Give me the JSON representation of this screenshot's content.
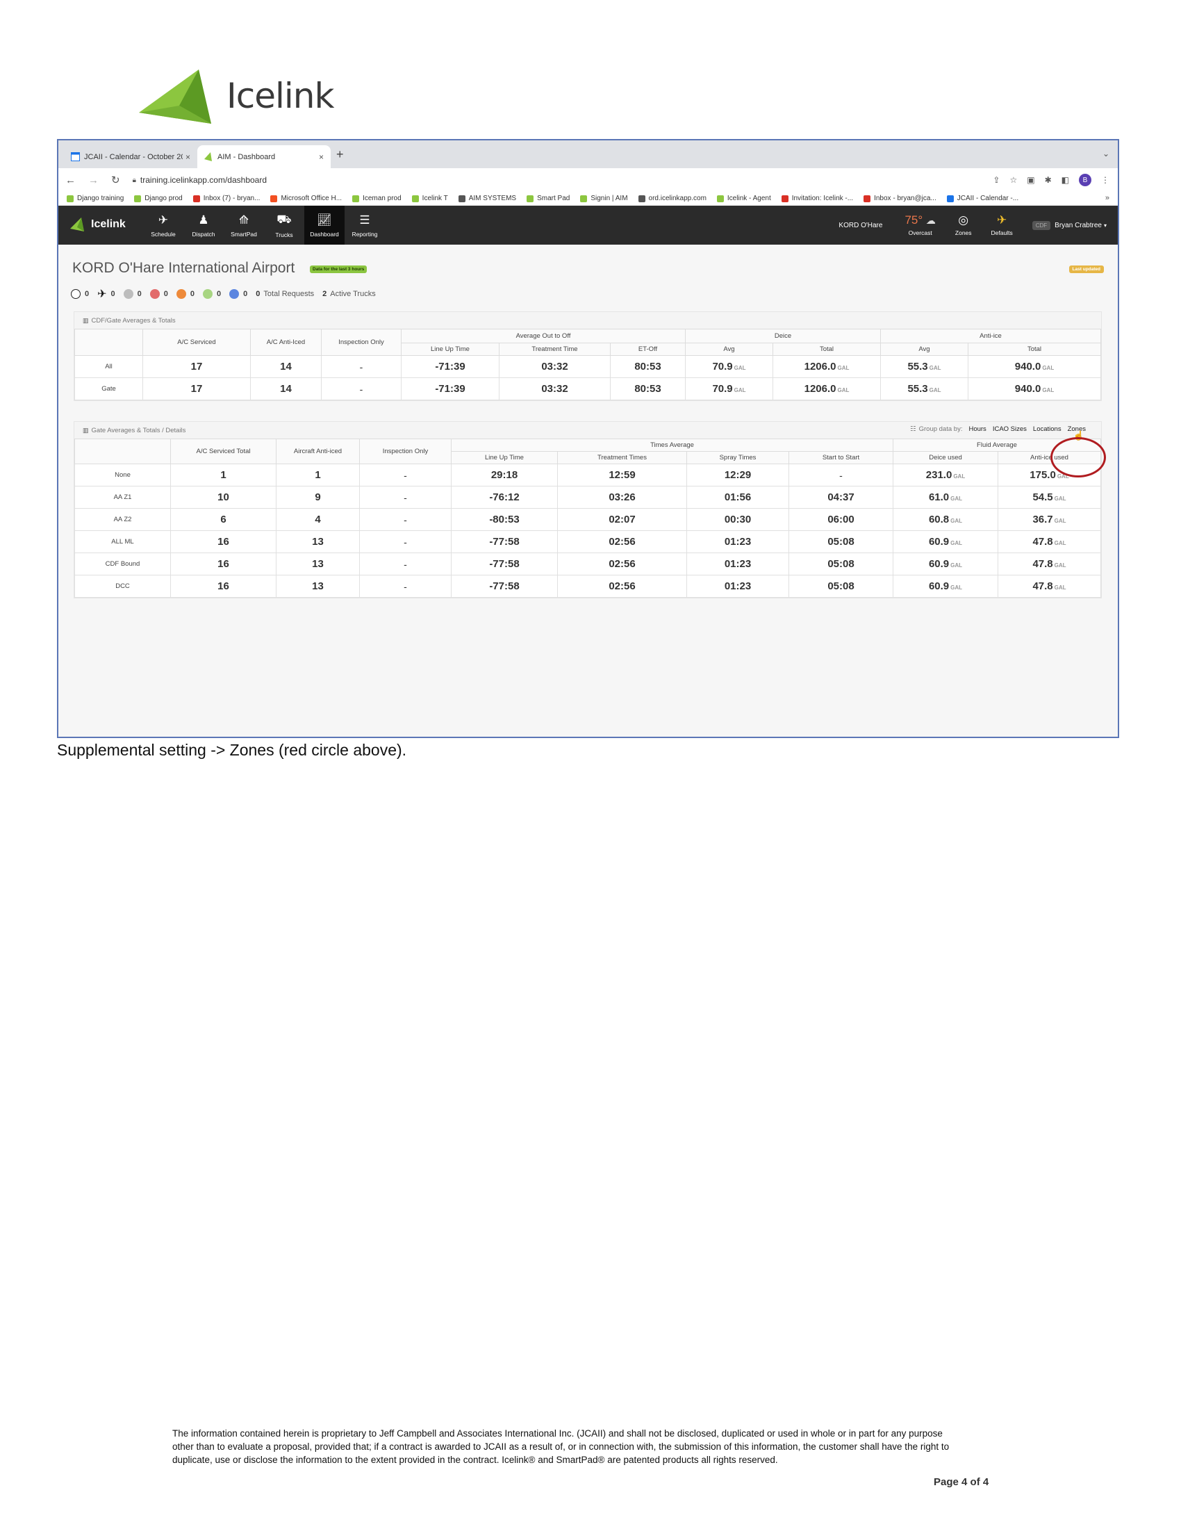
{
  "logo": {
    "text": "Icelink"
  },
  "browser": {
    "tabs": [
      {
        "title": "JCAII - Calendar - October 20..."
      },
      {
        "title": "AIM - Dashboard"
      }
    ],
    "url": "training.icelinkapp.com/dashboard",
    "profile_initial": "B",
    "bookmarks": [
      "Django training",
      "Django prod",
      "Inbox (7) - bryan...",
      "Microsoft Office H...",
      "Iceman prod",
      "Icelink T",
      "AIM SYSTEMS",
      "Smart Pad",
      "Signin | AIM",
      "ord.icelinkapp.com",
      "Icelink - Agent",
      "Invitation: Icelink -...",
      "Inbox - bryan@jca...",
      "JCAII - Calendar -..."
    ]
  },
  "app": {
    "brand": "Icelink",
    "nav": [
      {
        "label": "Schedule",
        "icon": "plane-takeoff-icon"
      },
      {
        "label": "Dispatch",
        "icon": "dispatch-icon"
      },
      {
        "label": "SmartPad",
        "icon": "smartpad-icon"
      },
      {
        "label": "Trucks",
        "icon": "truck-icon"
      },
      {
        "label": "Dashboard",
        "icon": "chart-icon"
      },
      {
        "label": "Reporting",
        "icon": "database-icon"
      }
    ],
    "airport_selector": "KORD O'Hare",
    "weather": {
      "temp": "75°",
      "label": "Overcast"
    },
    "zones_label": "Zones",
    "defaults_label": "Defaults",
    "user_badge": "CDF",
    "user_name": "Bryan Crabtree"
  },
  "dashboard": {
    "title": "KORD O'Hare International Airport",
    "range_badge": "Data for the last 3 hours",
    "updated_badge": "Last updated",
    "stats": [
      {
        "color": "#ffffff",
        "value": "0"
      },
      {
        "color": "plane",
        "value": "0"
      },
      {
        "color": "#bdbdbd",
        "value": "0"
      },
      {
        "color": "#e26b6b",
        "value": "0"
      },
      {
        "color": "#ee8a3a",
        "value": "0"
      },
      {
        "color": "#a8d582",
        "value": "0"
      },
      {
        "color": "#5c86e0",
        "value": "0"
      }
    ],
    "total_requests": {
      "value": "0",
      "label": "Total Requests"
    },
    "active_trucks": {
      "value": "2",
      "label": "Active Trucks"
    }
  },
  "cdf_table": {
    "header": "CDF/Gate Averages & Totals",
    "col_ac_serviced": "A/C Serviced",
    "col_ac_antiiced": "A/C Anti-Iced",
    "col_inspection": "Inspection Only",
    "group_avg_out": "Average Out to Off",
    "group_deice": "Deice",
    "group_antiice": "Anti-ice",
    "sub_lineup": "Line Up Time",
    "sub_treatment": "Treatment Time",
    "sub_etoff": "ET-Off",
    "sub_avg": "Avg",
    "sub_total": "Total",
    "unit": "GAL",
    "rows": [
      {
        "label": "All",
        "serviced": "17",
        "antiiced": "14",
        "inspection": "-",
        "lineup": "-71:39",
        "treatment": "03:32",
        "etoff": "80:53",
        "deice_avg": "70.9",
        "deice_total": "1206.0",
        "anti_avg": "55.3",
        "anti_total": "940.0"
      },
      {
        "label": "Gate",
        "serviced": "17",
        "antiiced": "14",
        "inspection": "-",
        "lineup": "-71:39",
        "treatment": "03:32",
        "etoff": "80:53",
        "deice_avg": "70.9",
        "deice_total": "1206.0",
        "anti_avg": "55.3",
        "anti_total": "940.0"
      }
    ]
  },
  "gate_table": {
    "header": "Gate Averages & Totals / Details",
    "group_by_label": "Group data by:",
    "group_options": [
      "Hours",
      "ICAO Sizes",
      "Locations",
      "Zones"
    ],
    "col_serviced": "A/C Serviced Total",
    "col_antiiced": "Aircraft Anti-iced",
    "col_inspection": "Inspection Only",
    "group_times": "Times Average",
    "group_fluid": "Fluid Average",
    "sub_lineup": "Line Up Time",
    "sub_treatment": "Treatment Times",
    "sub_spray": "Spray Times",
    "sub_start": "Start to Start",
    "sub_deice": "Deice used",
    "sub_antiice": "Anti-ice used",
    "unit": "GAL",
    "rows": [
      {
        "label": "None",
        "serviced": "1",
        "antiiced": "1",
        "inspection": "-",
        "lineup": "29:18",
        "treatment": "12:59",
        "spray": "12:29",
        "start": "-",
        "deice": "231.0",
        "antiice": "175.0"
      },
      {
        "label": "AA Z1",
        "serviced": "10",
        "antiiced": "9",
        "inspection": "-",
        "lineup": "-76:12",
        "treatment": "03:26",
        "spray": "01:56",
        "start": "04:37",
        "deice": "61.0",
        "antiice": "54.5"
      },
      {
        "label": "AA Z2",
        "serviced": "6",
        "antiiced": "4",
        "inspection": "-",
        "lineup": "-80:53",
        "treatment": "02:07",
        "spray": "00:30",
        "start": "06:00",
        "deice": "60.8",
        "antiice": "36.7"
      },
      {
        "label": "ALL ML",
        "serviced": "16",
        "antiiced": "13",
        "inspection": "-",
        "lineup": "-77:58",
        "treatment": "02:56",
        "spray": "01:23",
        "start": "05:08",
        "deice": "60.9",
        "antiice": "47.8"
      },
      {
        "label": "CDF Bound",
        "serviced": "16",
        "antiiced": "13",
        "inspection": "-",
        "lineup": "-77:58",
        "treatment": "02:56",
        "spray": "01:23",
        "start": "05:08",
        "deice": "60.9",
        "antiice": "47.8"
      },
      {
        "label": "DCC",
        "serviced": "16",
        "antiiced": "13",
        "inspection": "-",
        "lineup": "-77:58",
        "treatment": "02:56",
        "spray": "01:23",
        "start": "05:08",
        "deice": "60.9",
        "antiice": "47.8"
      }
    ]
  },
  "caption": "Supplemental setting -> Zones (red circle above).",
  "footer": {
    "text": "The information contained herein is proprietary to Jeff Campbell and Associates International Inc. (JCAII) and shall not be disclosed, duplicated or used in whole or in part for any purpose other than to evaluate a proposal, provided that; if a contract is awarded to JCAII as a result of, or in connection with, the submission of this information, the customer shall have the right to duplicate, use or disclose the information to the extent provided in the contract. Icelink® and SmartPad® are patented products all rights reserved.",
    "page": "Page 4 of 4"
  }
}
